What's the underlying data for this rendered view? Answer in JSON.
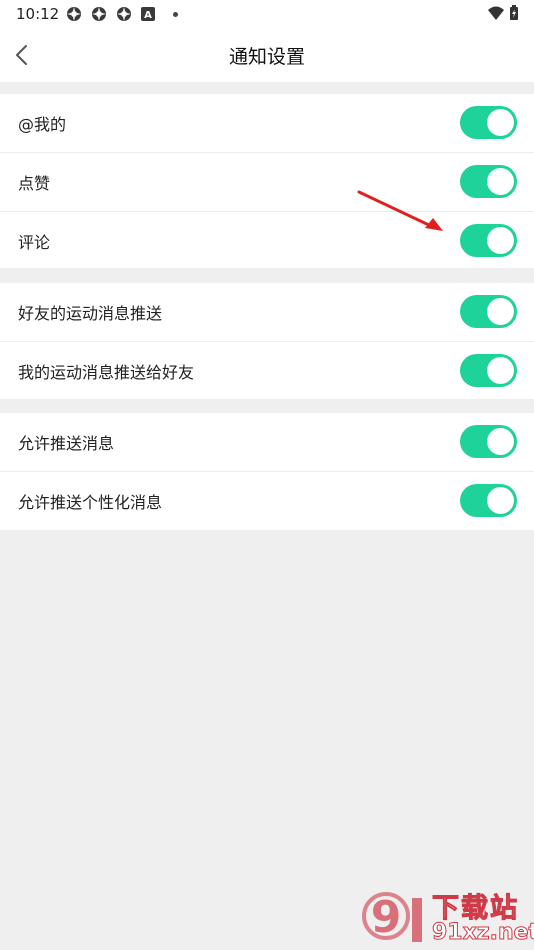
{
  "status_bar": {
    "time": "10:12",
    "app_badge": "A"
  },
  "header": {
    "title": "通知设置"
  },
  "groups": [
    {
      "rows": [
        {
          "label": "@我的",
          "enabled": true
        },
        {
          "label": "点赞",
          "enabled": true
        },
        {
          "label": "评论",
          "enabled": true
        }
      ]
    },
    {
      "rows": [
        {
          "label": "好友的运动消息推送",
          "enabled": true
        },
        {
          "label": "我的运动消息推送给好友",
          "enabled": true
        }
      ]
    },
    {
      "rows": [
        {
          "label": "允许推送消息",
          "enabled": true
        },
        {
          "label": "允许推送个性化消息",
          "enabled": true
        }
      ]
    }
  ],
  "watermark": {
    "logo_text": "9",
    "site_name": "下载站",
    "site_url": "91xz.net"
  },
  "colors": {
    "toggle_on": "#1dd39a",
    "background": "#efefef",
    "annotation_arrow": "#e02020",
    "watermark": "#cf3a48"
  }
}
